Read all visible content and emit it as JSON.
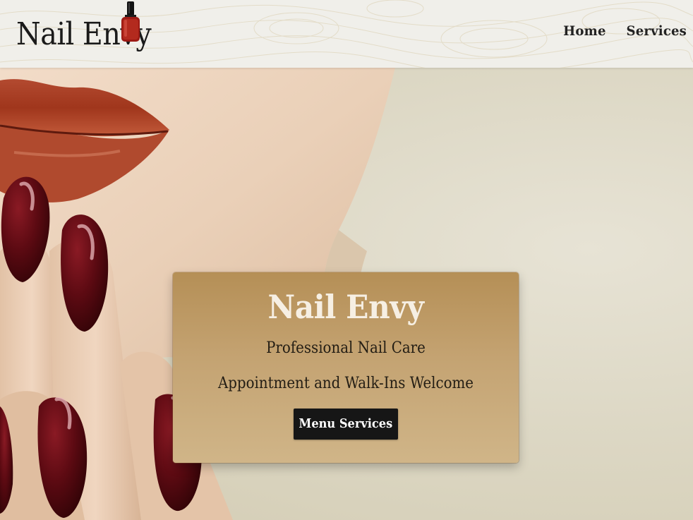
{
  "header": {
    "brand_name": "Nail Envy",
    "brand_icon": "nail-polish-bottle-icon",
    "nav": [
      {
        "label": "Home"
      },
      {
        "label": "Services"
      }
    ]
  },
  "hero": {
    "image": "woman-red-lips-dark-red-nails-photo",
    "card": {
      "title": "Nail Envy",
      "subtitle": "Professional Nail Care",
      "tagline": "Appointment and Walk-Ins Welcome",
      "button_label": "Menu Services"
    }
  },
  "colors": {
    "header_bg": "#f0efea",
    "card_top": "#b58f56",
    "card_bottom": "#d0b588",
    "button_bg": "#161616",
    "polish_red": "#5c0a12",
    "lip_red": "#a0361c"
  }
}
